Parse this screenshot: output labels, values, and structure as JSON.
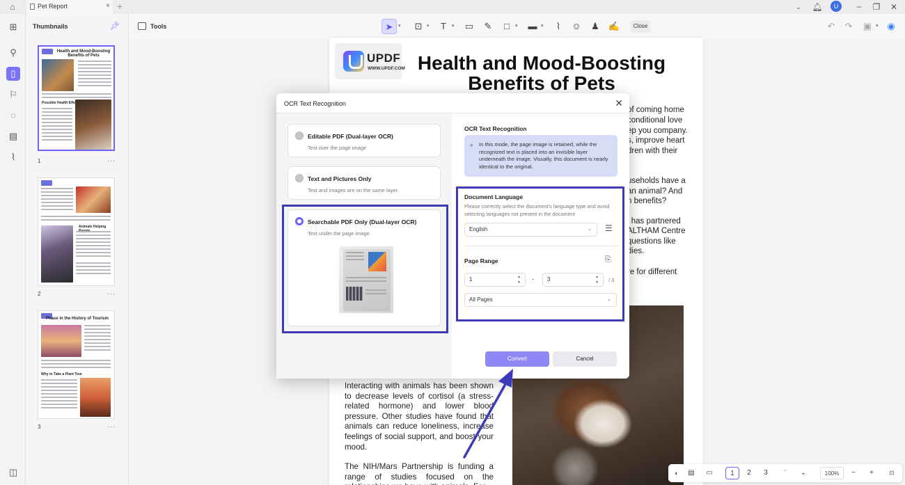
{
  "titlebar": {
    "tab_title": "Pet Report",
    "avatar_initial": "U"
  },
  "thumbnails": {
    "title": "Thumbnails",
    "pages": [
      {
        "number": "1",
        "title": "Health and Mood-Boosting Benefits of Pets",
        "subheading": "Possible Health Effects"
      },
      {
        "number": "2",
        "subheading": "Animals Helping People"
      },
      {
        "number": "3",
        "title": "Phase in the History of Tourism",
        "subheading": "Why to Take a Plant Tour"
      }
    ]
  },
  "toolbar": {
    "tools_label": "Tools",
    "close_label": "Close"
  },
  "document": {
    "logo_name": "UPDF",
    "logo_url": "WWW.UPDF.COM",
    "title": "Health and Mood-Boosting Benefits of Pets",
    "right_fragments": [
      "of coming home",
      "conditional love",
      "ep you company.",
      "s, improve heart",
      "dren  with  their",
      "useholds have a",
      "an animal? And",
      "n benefits?",
      "l  has  partnered",
      "ALTHAM Centre",
      "questions  like",
      "dies.",
      "re for different"
    ],
    "body_paragraphs": [
      "Interacting with animals has been shown to decrease levels of cortisol (a stress-related hormone) and lower blood pressure. Other studies have found that animals can reduce loneliness, increase feelings of social support, and boost your mood.",
      "The NIH/Mars Partnership is funding a range of studies focused on the relationships we have with animals. For"
    ]
  },
  "statusbar": {
    "pages": [
      "1",
      "2",
      "3"
    ],
    "current_page": "1",
    "zoom": "100%"
  },
  "ocr_dialog": {
    "title": "OCR Text Recognition",
    "options": [
      {
        "title": "Editable PDF (Dual-layer OCR)",
        "subtitle": "Text over the page image",
        "selected": false
      },
      {
        "title": "Text and Pictures Only",
        "subtitle": "Text and images are on the same layer.",
        "selected": false
      },
      {
        "title": "Searchable PDF Only (Dual-layer OCR)",
        "subtitle": "Text under the page image",
        "selected": true
      }
    ],
    "right_title": "OCR Text Recognition",
    "info_text": "In this mode, the page image is retained, while the recognized text is placed into an invisible layer underneath the image. Visually, this document is nearly identical to the original.",
    "language": {
      "label": "Document Language",
      "hint": "Please correctly select the document's language type and avoid selecting languages not present in the document",
      "value": "English"
    },
    "page_range": {
      "label": "Page Range",
      "from": "1",
      "separator": "-",
      "to": "3",
      "total": "/ 3",
      "subset": "All Pages"
    },
    "convert_label": "Convert",
    "cancel_label": "Cancel"
  },
  "colors": {
    "accent": "#6c63ff",
    "highlight_border": "#3e3bb9",
    "convert_button": "#8f86f8",
    "info_box": "#d7dcf7"
  }
}
